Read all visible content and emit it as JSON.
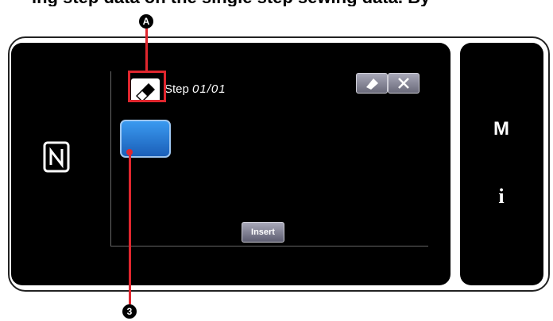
{
  "caption": "ing step data on the single step sewing data. By",
  "screen": {
    "step_prefix": "Step",
    "step_value": "01/01",
    "insert_label": "Insert"
  },
  "side": {
    "menu_label": "M",
    "info_label": "i"
  },
  "annotations": {
    "marker_a": "A",
    "marker_3": "3"
  },
  "colors": {
    "accent_red": "#e0262e",
    "button_blue": "#2a7fd8"
  },
  "icons": {
    "step": "pencil-eraser-icon",
    "edit": "eraser-icon",
    "close": "close-icon",
    "nfc": "nfc-icon",
    "menu": "m-icon",
    "info": "info-icon"
  }
}
